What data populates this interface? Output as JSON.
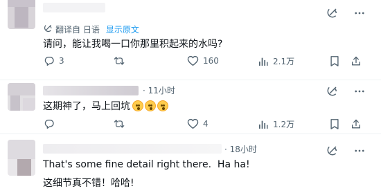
{
  "tweets": [
    {
      "translated_note": "翻译自 日语",
      "show_original": "显示原文",
      "text": "请问，能让我喝一口你那里积起来的水吗?",
      "reply_count": "3",
      "like_count": "160",
      "view_count": "2.1万"
    },
    {
      "time": "· 11小时",
      "text": "这期神了，马上回坑",
      "emojis": [
        "hushed-face-emoji",
        "hushed-face-emoji",
        "hushed-face-emoji"
      ],
      "like_count": "4",
      "view_count": "1.2万"
    },
    {
      "time": "· 18小时",
      "text_en": "That's some fine detail right there.  Ha ha!",
      "text_cn": "这细节真不错！哈哈!"
    }
  ],
  "colors": {
    "text": "#0f1419",
    "secondary": "#536471",
    "link": "#1d9bf0",
    "divider": "#eff3f4"
  },
  "icons": [
    "grok-icon",
    "more-icon",
    "translate-icon",
    "reply-icon",
    "retweet-icon",
    "like-icon",
    "views-icon",
    "bookmark-icon",
    "share-icon"
  ]
}
